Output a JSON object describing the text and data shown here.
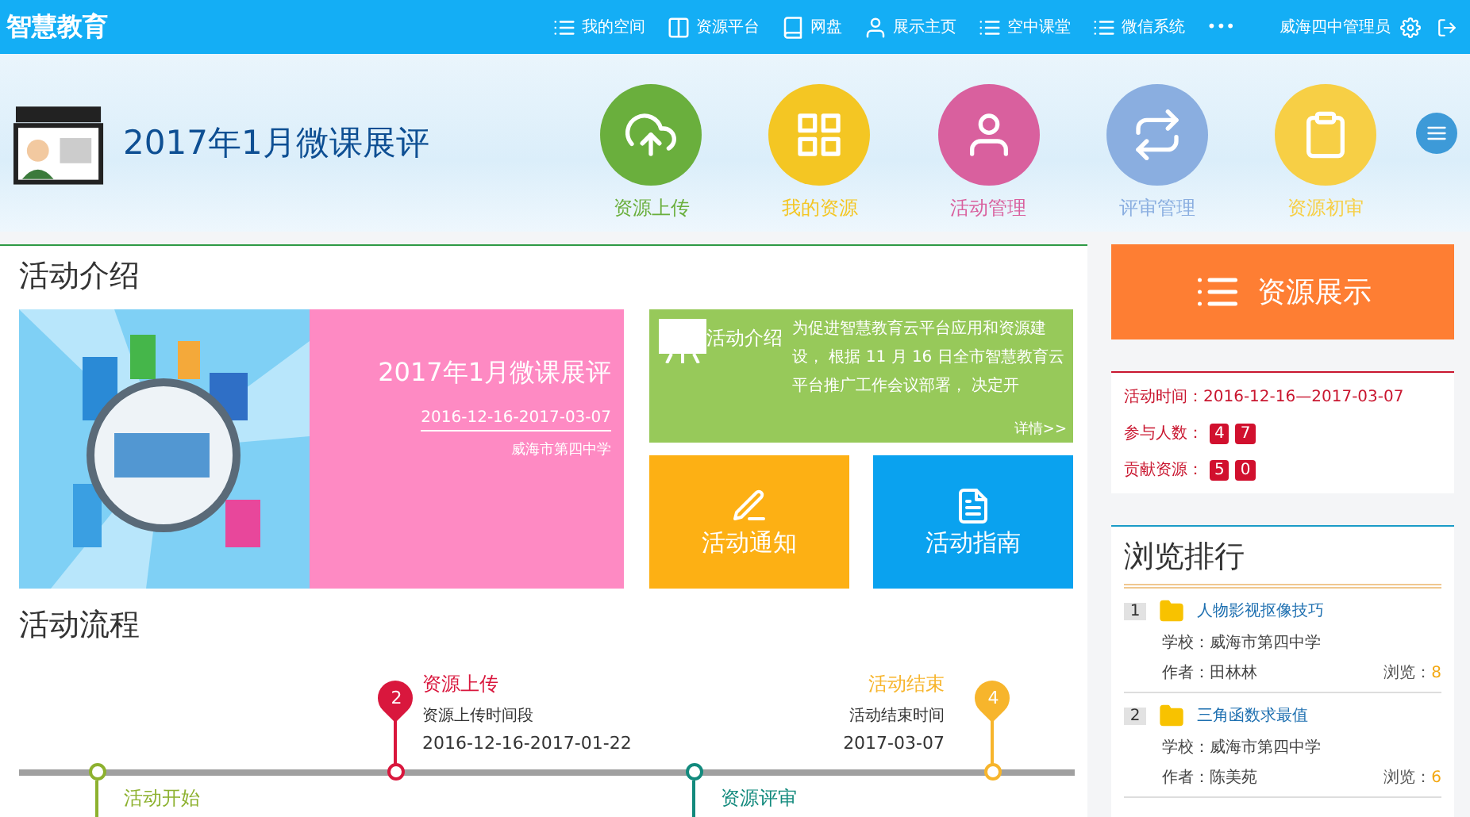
{
  "top_bar": {
    "logo": "智慧教育",
    "nav": [
      {
        "label": "我的空间"
      },
      {
        "label": "资源平台"
      },
      {
        "label": "网盘"
      },
      {
        "label": "展示主页"
      },
      {
        "label": "空中课堂"
      },
      {
        "label": "微信系统"
      }
    ],
    "more": "•••",
    "user": "威海四中管理员"
  },
  "banner": {
    "title": "2017年1月微课展评",
    "actions": [
      {
        "label": "资源上传",
        "color": "#6aaf3d"
      },
      {
        "label": "我的资源",
        "color": "#f4c623"
      },
      {
        "label": "活动管理",
        "color": "#d9609e"
      },
      {
        "label": "评审管理",
        "color": "#8aaee0"
      },
      {
        "label": "资源初审",
        "color": "#f7cf45"
      }
    ]
  },
  "intro": {
    "heading": "活动介绍",
    "title": "2017年1月微课展评",
    "dates": "2016-12-16-2017-03-07",
    "school": "威海市第四中学",
    "summary_label": "活动介绍",
    "summary": "为促进智慧教育云平台应用和资源建设， 根据 11 月 16 日全市智慧教育云平台推广工作会议部署， 决定开",
    "more": "详情>>",
    "tiles": [
      {
        "label": "活动通知",
        "color": "#fdb014"
      },
      {
        "label": "活动指南",
        "color": "#0aa2ef"
      }
    ]
  },
  "process": {
    "heading": "活动流程",
    "steps": [
      {
        "kind": "bottom",
        "title": "活动开始",
        "color": "#8db12f"
      },
      {
        "kind": "top",
        "number": "2",
        "title": "资源上传",
        "desc": "资源上传时间段",
        "date": "2016-12-16-2017-01-22",
        "color": "#d9173d"
      },
      {
        "kind": "bottom",
        "title": "资源评审",
        "color": "#138a7d"
      },
      {
        "kind": "top",
        "number": "4",
        "title": "活动结束",
        "desc": "活动结束时间",
        "date": "2017-03-07",
        "color": "#f7b52c"
      }
    ]
  },
  "showcase": {
    "label": "资源展示"
  },
  "stats": {
    "time_label": "活动时间：",
    "time": "2016-12-16—2017-03-07",
    "rows": [
      {
        "label": "参与人数：",
        "digits": [
          "4",
          "7"
        ]
      },
      {
        "label": "贡献资源：",
        "digits": [
          "5",
          "0"
        ]
      }
    ]
  },
  "ranking": {
    "heading": "浏览排行",
    "items": [
      {
        "rank": "1",
        "title": "人物影视抠像技巧",
        "school": "学校：威海市第四中学",
        "author": "作者：田林林",
        "views_label": "浏览：",
        "views": "8"
      },
      {
        "rank": "2",
        "title": "三角函数求最值",
        "school": "学校：威海市第四中学",
        "author": "作者：陈美苑",
        "views_label": "浏览：",
        "views": "6"
      }
    ]
  }
}
